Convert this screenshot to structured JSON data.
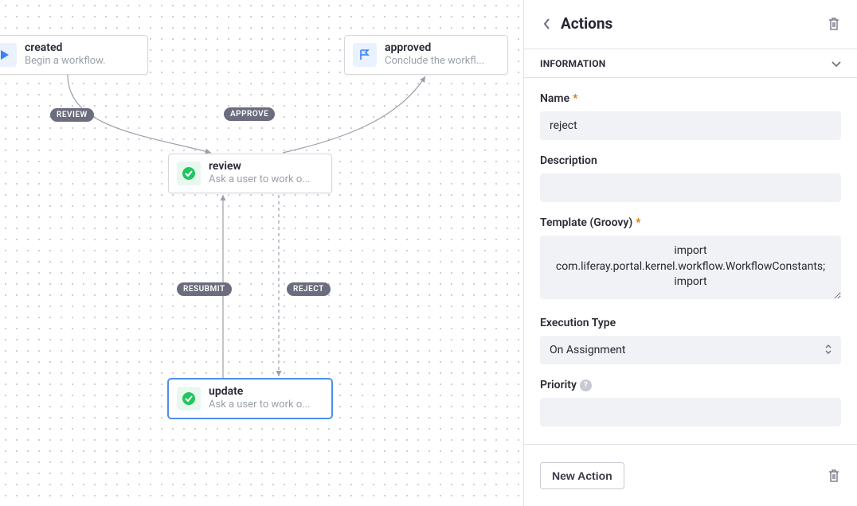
{
  "panel": {
    "title": "Actions",
    "section_info_label": "INFORMATION",
    "fields": {
      "name_label": "Name",
      "name_value": "reject",
      "description_label": "Description",
      "description_value": "",
      "template_label": "Template (Groovy)",
      "template_value": "import com.liferay.portal.kernel.workflow.WorkflowConstants;\nimport",
      "execution_type_label": "Execution Type",
      "execution_type_value": "On Assignment",
      "priority_label": "Priority",
      "priority_value": ""
    },
    "new_action_label": "New Action"
  },
  "nodes": {
    "created": {
      "title": "created",
      "sub": "Begin a workflow."
    },
    "approved": {
      "title": "approved",
      "sub": "Conclude the workfl..."
    },
    "review": {
      "title": "review",
      "sub": "Ask a user to work o..."
    },
    "update": {
      "title": "update",
      "sub": "Ask a user to work o..."
    }
  },
  "edge_labels": {
    "review_label": "REVIEW",
    "approve_label": "APPROVE",
    "resubmit_label": "RESUBMIT",
    "reject_label": "REJECT"
  }
}
